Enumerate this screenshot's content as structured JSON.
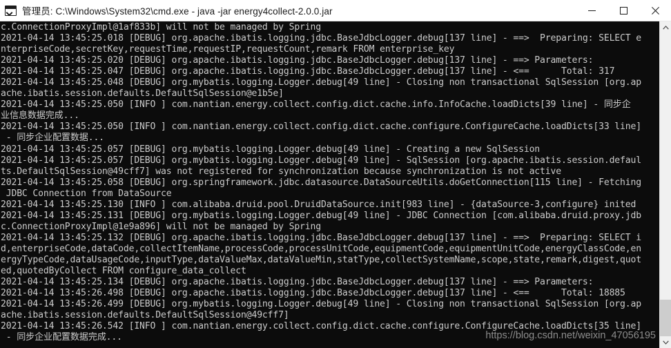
{
  "window": {
    "title": "管理员: C:\\Windows\\System32\\cmd.exe - java  -jar energy4collect-2.0.0.jar",
    "icon": "cmd-console-icon",
    "controls": {
      "minimize": "minimize-button",
      "maximize": "maximize-button",
      "close": "close-button"
    }
  },
  "colors": {
    "console_background": "#0c0c0c",
    "console_text": "#cccccc",
    "titlebar_background": "#ffffff",
    "titlebar_text": "#1a1a1a",
    "scrollbar_track": "#f0f0f0",
    "scrollbar_thumb": "#cdcdcd",
    "watermark_text": "#8d8d8d"
  },
  "console": {
    "lines": [
      "c.ConnectionProxyImpl@1af833b] will not be managed by Spring",
      "2021-04-14 13:45:25.018 [DEBUG] org.apache.ibatis.logging.jdbc.BaseJdbcLogger.debug[137 line] - ==>  Preparing: SELECT e",
      "nterpriseCode,secretKey,requestTime,requestIP,requestCount,remark FROM enterprise_key",
      "2021-04-14 13:45:25.020 [DEBUG] org.apache.ibatis.logging.jdbc.BaseJdbcLogger.debug[137 line] - ==> Parameters:",
      "2021-04-14 13:45:25.047 [DEBUG] org.apache.ibatis.logging.jdbc.BaseJdbcLogger.debug[137 line] - <==      Total: 317",
      "2021-04-14 13:45:25.048 [DEBUG] org.mybatis.logging.Logger.debug[49 line] - Closing non transactional SqlSession [org.ap",
      "ache.ibatis.session.defaults.DefaultSqlSession@e1b5e]",
      "2021-04-14 13:45:25.050 [INFO ] com.nantian.energy.collect.config.dict.cache.info.InfoCache.loadDicts[39 line] - 同步企",
      "业信息数据完成...",
      "2021-04-14 13:45:25.050 [INFO ] com.nantian.energy.collect.config.dict.cache.configure.ConfigureCache.loadDicts[33 line]",
      " - 同步企业配置数据...",
      "2021-04-14 13:45:25.057 [DEBUG] org.mybatis.logging.Logger.debug[49 line] - Creating a new SqlSession",
      "2021-04-14 13:45:25.057 [DEBUG] org.mybatis.logging.Logger.debug[49 line] - SqlSession [org.apache.ibatis.session.defaul",
      "ts.DefaultSqlSession@49cff7] was not registered for synchronization because synchronization is not active",
      "2021-04-14 13:45:25.058 [DEBUG] org.springframework.jdbc.datasource.DataSourceUtils.doGetConnection[115 line] - Fetching",
      " JDBC Connection from DataSource",
      "2021-04-14 13:45:25.130 [INFO ] com.alibaba.druid.pool.DruidDataSource.init[983 line] - {dataSource-3,configure} inited",
      "2021-04-14 13:45:25.131 [DEBUG] org.mybatis.logging.Logger.debug[49 line] - JDBC Connection [com.alibaba.druid.proxy.jdb",
      "c.ConnectionProxyImpl@1e9a896] will not be managed by Spring",
      "2021-04-14 13:45:25.132 [DEBUG] org.apache.ibatis.logging.jdbc.BaseJdbcLogger.debug[137 line] - ==>  Preparing: SELECT i",
      "d,enterpriseCode,dataCode,collectItemName,processCode,processUnitCode,equipmentCode,equipmentUnitCode,energyClassCode,en",
      "ergyTypeCode,dataUsageCode,inputType,dataValueMax,dataValueMin,statType,collectSystemName,scope,state,remark,digest,quot",
      "ed,quotedByCollect FROM configure_data_collect",
      "2021-04-14 13:45:25.134 [DEBUG] org.apache.ibatis.logging.jdbc.BaseJdbcLogger.debug[137 line] - ==> Parameters:",
      "2021-04-14 13:45:26.498 [DEBUG] org.apache.ibatis.logging.jdbc.BaseJdbcLogger.debug[137 line] - <==      Total: 18885",
      "2021-04-14 13:45:26.499 [DEBUG] org.mybatis.logging.Logger.debug[49 line] - Closing non transactional SqlSession [org.ap",
      "ache.ibatis.session.defaults.DefaultSqlSession@49cff7]",
      "2021-04-14 13:45:26.542 [INFO ] com.nantian.energy.collect.config.dict.cache.configure.ConfigureCache.loadDicts[35 line]",
      " - 同步企业配置数据完成..."
    ]
  },
  "scrollbar": {
    "up_arrow": "scroll-up-icon",
    "down_arrow": "scroll-down-icon",
    "thumb_top_percent": 88,
    "thumb_height_percent": 12
  },
  "watermark": {
    "text": "https://blog.csdn.net/weixin_47056195"
  }
}
